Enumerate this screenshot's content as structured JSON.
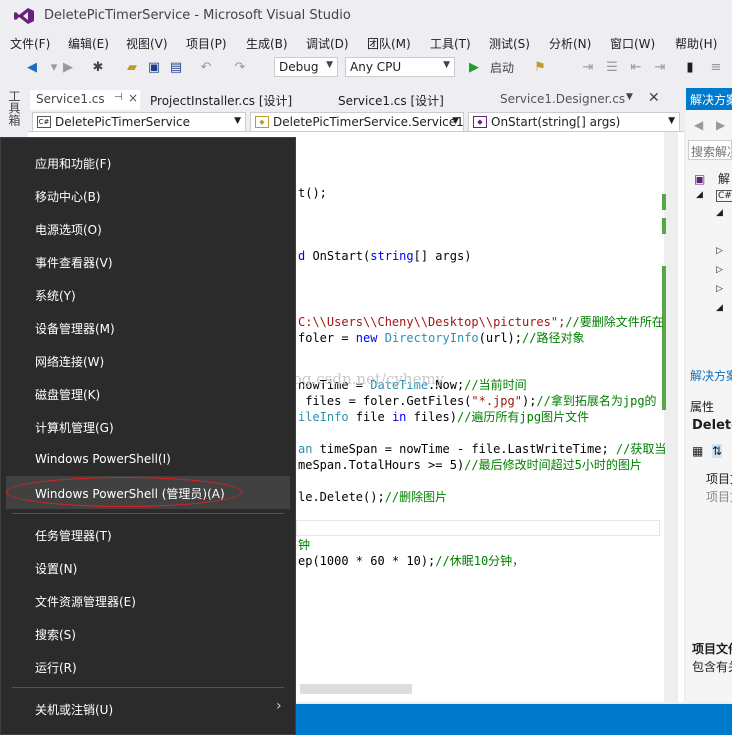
{
  "window": {
    "title": "DeletePicTimerService - Microsoft Visual Studio"
  },
  "menu": [
    "文件(F)",
    "编辑(E)",
    "视图(V)",
    "项目(P)",
    "生成(B)",
    "调试(D)",
    "团队(M)",
    "工具(T)",
    "测试(S)",
    "分析(N)",
    "窗口(W)",
    "帮助(H)"
  ],
  "toolbar": {
    "config": "Debug",
    "platform": "Any CPU",
    "start_label": "启动"
  },
  "left_strip": {
    "toolbox": "工具箱"
  },
  "tabs": [
    {
      "label": "Service1.cs",
      "pin": "⊣",
      "close": "×"
    },
    {
      "label": "ProjectInstaller.cs [设计]"
    },
    {
      "label": "Service1.cs [设计]"
    },
    {
      "label": "Service1.Designer.cs"
    }
  ],
  "navbar": {
    "project": "DeletePicTimerService",
    "class": "DeletePicTimerService.Service1",
    "member": "OnStart(string[] args)"
  },
  "code": {
    "l1": "t();",
    "l2a": "d",
    "l2b": " OnStart(",
    "l2c": "string",
    "l2d": "[] args)",
    "l3a": "C:\\\\Users\\\\Cheny\\\\Desktop\\\\pictures\";",
    "l3b": "//要删除文件所在",
    "l4a": "foler = ",
    "l4b": "new",
    "l4c": " ",
    "l4d": "DirectoryInfo",
    "l4e": "(url);",
    "l4f": "//路径对象",
    "l5a": "nowTime = ",
    "l5b": "DateTime",
    "l5c": ".Now;",
    "l5d": "//当前时间",
    "l6a": " files = foler.GetFiles(",
    "l6b": "\"*.jpg\"",
    "l6c": ");",
    "l6d": "//拿到拓展名为jpg的",
    "l7a": "ileInfo",
    "l7b": " file ",
    "l7c": "in",
    "l7d": " files)",
    "l7e": "//遍历所有jpg图片文件",
    "l8a": "an",
    "l8b": " timeSpan = nowTime - file.LastWriteTime; ",
    "l8c": "//获取当",
    "l9a": "meSpan.TotalHours >= 5)",
    "l9b": "//最后修改时间超过5小时的图片",
    "l10a": "le.Delete();",
    "l10b": "//删除图片",
    "l11": "钟",
    "l12a": "ep(1000 * 60 * 10);",
    "l12b": "//休眠10分钟，"
  },
  "watermark": "http://blog.csdn.net/cyhemy",
  "solution_explorer": {
    "header": "解决方案",
    "search": "搜索解决",
    "items": [
      "解",
      "C#"
    ],
    "footer": "解决方案"
  },
  "properties": {
    "header": "属性",
    "name": "Delete",
    "rows": [
      "项目文",
      "项目文"
    ],
    "desc_title": "项目文件",
    "desc": "包含有关"
  },
  "context_menu": {
    "items": [
      "应用和功能(F)",
      "移动中心(B)",
      "电源选项(O)",
      "事件查看器(V)",
      "系统(Y)",
      "设备管理器(M)",
      "网络连接(W)",
      "磁盘管理(K)",
      "计算机管理(G)",
      "Windows PowerShell(I)",
      "Windows PowerShell (管理员)(A)",
      "任务管理器(T)",
      "设置(N)",
      "文件资源管理器(E)",
      "搜索(S)",
      "运行(R)",
      "关机或注销(U)"
    ],
    "highlighted": "Windows PowerShell (管理员)(A)"
  },
  "colors": {
    "accent": "#007acc",
    "menu_bg": "#2b2b2b",
    "highlight_ring": "#e02020"
  }
}
